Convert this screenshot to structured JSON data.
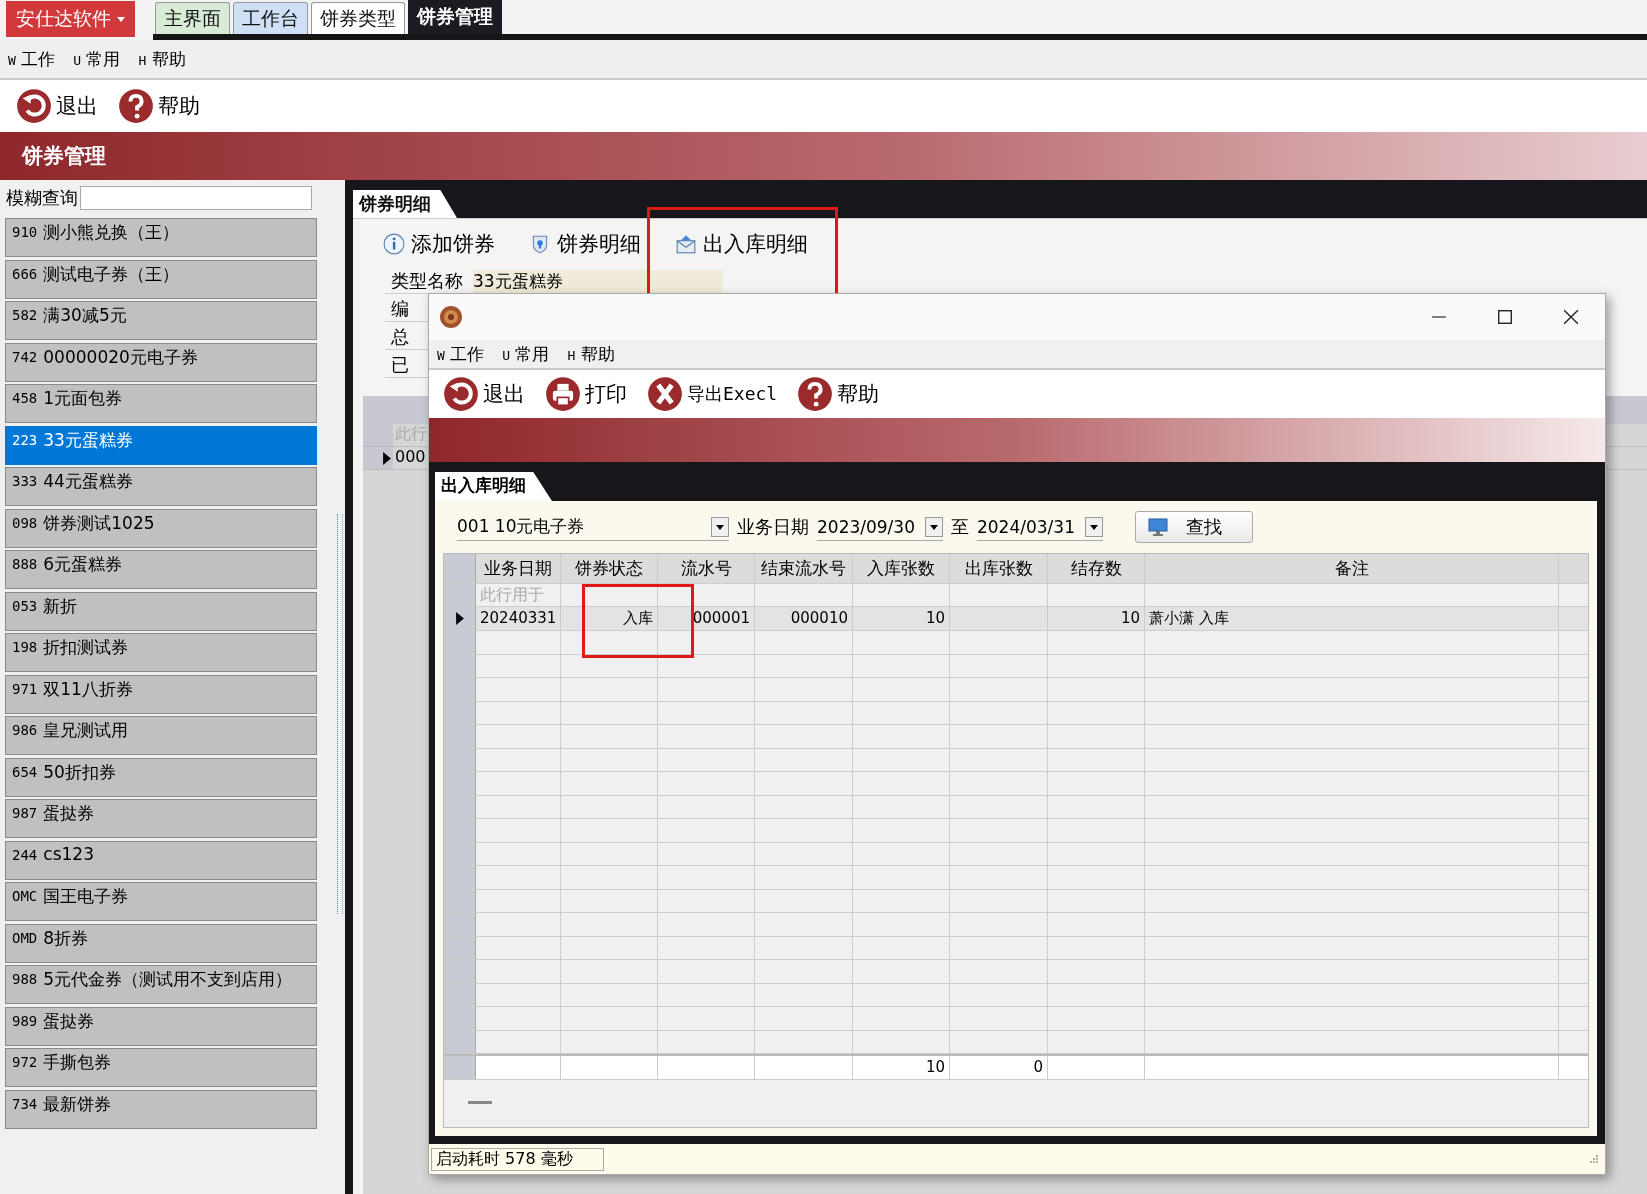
{
  "app_menu": {
    "label": "安仕达软件"
  },
  "tabs": [
    {
      "label": "主界面",
      "selected": false,
      "color": "#d8ebd6"
    },
    {
      "label": "工作台",
      "selected": false,
      "color": "#cfe0f6"
    },
    {
      "label": "饼券类型",
      "selected": false,
      "color": "#ffffff"
    },
    {
      "label": "饼券管理",
      "selected": true,
      "color": "#1c1b21"
    }
  ],
  "menu": [
    {
      "key": "W",
      "label": "工作"
    },
    {
      "key": "U",
      "label": "常用"
    },
    {
      "key": "H",
      "label": "帮助"
    }
  ],
  "toolbar": [
    {
      "kind": "exit",
      "label": "退出"
    },
    {
      "kind": "help",
      "label": "帮助"
    }
  ],
  "header": "饼券管理",
  "search": {
    "label": "模糊查询"
  },
  "coupon_list": [
    {
      "code": "910",
      "name": "测小熊兑换（王）",
      "selected": false
    },
    {
      "code": "666",
      "name": "测试电子券（王）",
      "selected": false
    },
    {
      "code": "582",
      "name": "满30减5元",
      "selected": false
    },
    {
      "code": "742",
      "name": "00000020元电子券",
      "selected": false
    },
    {
      "code": "458",
      "name": "1元面包券",
      "selected": false
    },
    {
      "code": "223",
      "name": "33元蛋糕券",
      "selected": true
    },
    {
      "code": "333",
      "name": "44元蛋糕券",
      "selected": false
    },
    {
      "code": "098",
      "name": "饼券测试1025",
      "selected": false
    },
    {
      "code": "888",
      "name": "6元蛋糕券",
      "selected": false
    },
    {
      "code": "053",
      "name": "新折",
      "selected": false
    },
    {
      "code": "198",
      "name": "折扣测试券",
      "selected": false
    },
    {
      "code": "971",
      "name": "双11八折券",
      "selected": false
    },
    {
      "code": "986",
      "name": "皇兄测试用",
      "selected": false
    },
    {
      "code": "654",
      "name": "50折扣券",
      "selected": false
    },
    {
      "code": "987",
      "name": "蛋挞券",
      "selected": false
    },
    {
      "code": "244",
      "name": "cs123",
      "selected": false
    },
    {
      "code": "OMC",
      "name": "国王电子券",
      "selected": false
    },
    {
      "code": "OMD",
      "name": "8折券",
      "selected": false
    },
    {
      "code": "988",
      "name": "5元代金券（测试用不支到店用）",
      "selected": false
    },
    {
      "code": "989",
      "name": "蛋挞券",
      "selected": false
    },
    {
      "code": "972",
      "name": "手撕包券",
      "selected": false
    },
    {
      "code": "734",
      "name": "最新饼券",
      "selected": false
    }
  ],
  "detail_panel": {
    "tab": "饼券明细",
    "actions": [
      {
        "kind": "info",
        "label": "添加饼券",
        "highlighted": false
      },
      {
        "kind": "shield",
        "label": "饼券明细",
        "highlighted": false
      },
      {
        "kind": "mail",
        "label": "出入库明细",
        "highlighted": true
      }
    ],
    "fields": [
      {
        "label": "类型名称",
        "value": "33元蛋糕券"
      },
      {
        "label": "编"
      },
      {
        "label": "总"
      },
      {
        "label": "已"
      }
    ],
    "grid": {
      "filter_row": "此行",
      "rows": [
        {
          "cell": "000",
          "current": true
        }
      ]
    }
  },
  "popup": {
    "menu": [
      {
        "key": "W",
        "label": "工作"
      },
      {
        "key": "U",
        "label": "常用"
      },
      {
        "key": "H",
        "label": "帮助"
      }
    ],
    "toolbar": [
      {
        "kind": "exit",
        "label": "退出"
      },
      {
        "kind": "print",
        "label": "打印"
      },
      {
        "kind": "excel",
        "label": "导出Execl"
      },
      {
        "kind": "help",
        "label": "帮助"
      }
    ],
    "tab": "出入库明细",
    "filter": {
      "coupon": "001 10元电子券",
      "date_label": "业务日期",
      "from": "2023/09/30",
      "to_label": "至",
      "to": "2024/03/31",
      "search_button": "查找"
    },
    "columns": [
      {
        "label": "业务日期",
        "highlighted": false
      },
      {
        "label": "饼券状态",
        "highlighted": true
      },
      {
        "label": "流水号",
        "highlighted": false
      },
      {
        "label": "结束流水号",
        "highlighted": false
      },
      {
        "label": "入库张数",
        "highlighted": false,
        "total": "10"
      },
      {
        "label": "出库张数",
        "highlighted": false,
        "total": "0"
      },
      {
        "label": "结存数",
        "highlighted": false
      },
      {
        "label": "备注",
        "highlighted": false
      }
    ],
    "filter_row": "此行用于",
    "rows": [
      {
        "current": true,
        "cells": [
          "20240331",
          "入库",
          "000001",
          "000010",
          "10",
          "",
          "10",
          "萧小潇 入库"
        ]
      }
    ],
    "status": "启动耗时 578 毫秒"
  }
}
